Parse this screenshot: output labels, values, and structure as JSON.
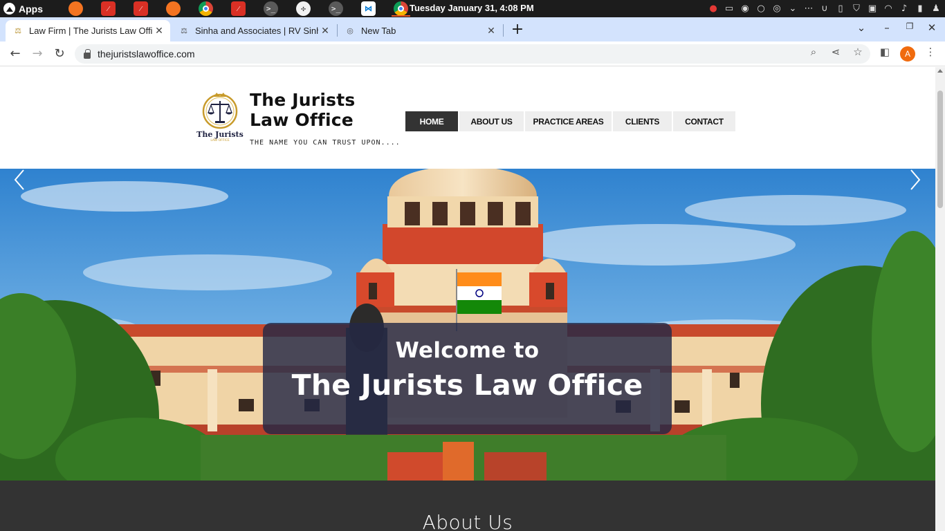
{
  "os": {
    "apps_label": "Apps",
    "clock": "Tuesday January 31,  4:08 PM",
    "dock_icons": [
      "firefox-icon",
      "pdf-icon",
      "pdf-icon",
      "firefox-icon",
      "chrome-icon",
      "pdf-icon",
      "terminal-icon",
      "fan-icon",
      "terminal-icon",
      "vscode-icon",
      "chrome-icon"
    ],
    "tray_icons": [
      "mic-off-icon",
      "screen-icon",
      "record-icon",
      "circle-icon",
      "app-icon",
      "chevron-down-icon",
      "more-icon",
      "u-icon",
      "clipboard-icon",
      "shield-icon",
      "display-icon",
      "wifi-icon",
      "music-icon",
      "battery-icon",
      "user-icon"
    ]
  },
  "browser": {
    "tabs": [
      {
        "title": "Law Firm | The Jurists Law Office",
        "favicon": "jurists-favicon",
        "active": true
      },
      {
        "title": "Sinha and Associates | RV Sinha",
        "favicon": "sinha-favicon",
        "active": false
      },
      {
        "title": "New Tab",
        "favicon": "chrome-icon",
        "active": false
      }
    ],
    "url": "thejuristslawoffice.com",
    "profile_initial": "A"
  },
  "site": {
    "brand_line1": "The Jurists",
    "brand_line2": "Law Office",
    "tagline": "THE NAME YOU CAN TRUST UPON....",
    "logo_text": "The Jurists",
    "logo_subtext": "LAW OFFICE",
    "nav": [
      "HOME",
      "ABOUT US",
      "PRACTICE AREAS",
      "CLIENTS",
      "CONTACT"
    ],
    "active_nav": "HOME",
    "hero_line1": "Welcome to",
    "hero_line2": "The Jurists Law Office",
    "about_title": "About Us"
  },
  "colors": {
    "nav_active": "#333333",
    "nav_bg": "#eeeeee",
    "hero_box": "#232846",
    "about_bg": "#333333",
    "tab_strip": "#d3e3fd"
  }
}
